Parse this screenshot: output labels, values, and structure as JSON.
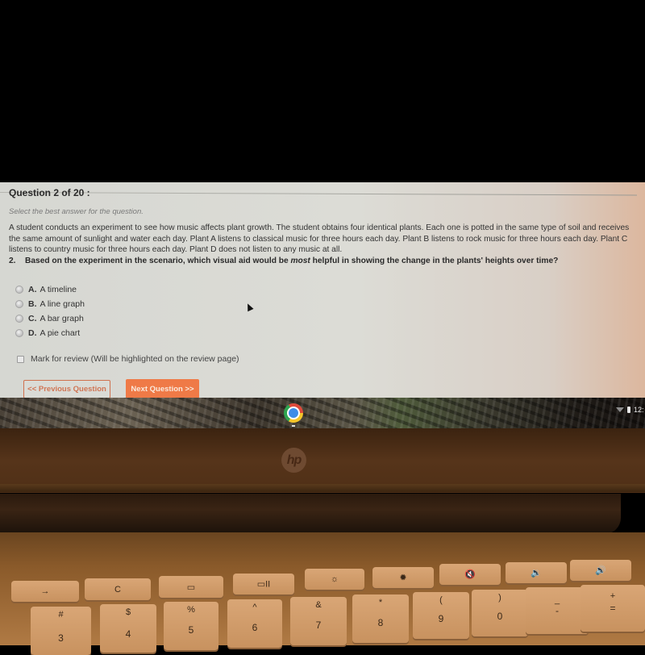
{
  "quiz": {
    "title": "Question 2 of 20 :",
    "instructions": "Select the best answer for the question.",
    "scenario": "A student conducts an experiment to see how music affects plant growth. The student obtains four identical plants. Each one is potted in the same type of soil and receives the same amount of sunlight and water each day. Plant A listens to classical music for three hours each day. Plant B listens to rock music for three hours each day. Plant C listens to country music for three hours each day. Plant D does not listen to any music at all.",
    "question_number": "2.",
    "question_before": "Based on the experiment in the scenario, which visual aid would be ",
    "question_emphasis": "most",
    "question_after": " helpful in showing the change in the plants' heights over time?",
    "options": [
      {
        "letter": "A.",
        "text": "A timeline",
        "selected": false
      },
      {
        "letter": "B.",
        "text": "A line graph",
        "selected": false
      },
      {
        "letter": "C.",
        "text": "A bar graph",
        "selected": false
      },
      {
        "letter": "D.",
        "text": "A pie chart",
        "selected": false
      }
    ],
    "mark_for_review": {
      "label": "Mark for review (Will be highlighted on the review page)",
      "checked": false
    },
    "prev_button": "<< Previous Question",
    "next_button": "Next Question >>",
    "accent_color": "#ef7a47"
  },
  "shelf": {
    "apps": [
      {
        "name": "Google Chrome",
        "icon": "chrome-icon"
      }
    ],
    "tray": {
      "wifi_icon": "wifi-icon",
      "battery_icon": "battery-icon",
      "time": "12:"
    }
  },
  "laptop": {
    "logo": "hp",
    "keyboard": {
      "function_row": [
        {
          "icon": "forward-icon",
          "glyph": "→"
        },
        {
          "icon": "refresh-icon",
          "glyph": "C"
        },
        {
          "icon": "fullscreen-icon",
          "glyph": "▭"
        },
        {
          "icon": "overview-icon",
          "glyph": "▭II"
        },
        {
          "icon": "brightness-down-icon",
          "glyph": "☼"
        },
        {
          "icon": "brightness-up-icon",
          "glyph": "✹"
        },
        {
          "icon": "mute-icon",
          "glyph": "🔇"
        },
        {
          "icon": "volume-down-icon",
          "glyph": "🔉"
        },
        {
          "icon": "volume-up-icon",
          "glyph": "🔊"
        }
      ],
      "number_row": [
        {
          "top": "#",
          "bottom": "3"
        },
        {
          "top": "$",
          "bottom": "4"
        },
        {
          "top": "%",
          "bottom": "5"
        },
        {
          "top": "^",
          "bottom": "6"
        },
        {
          "top": "&",
          "bottom": "7"
        },
        {
          "top": "*",
          "bottom": "8"
        },
        {
          "top": "(",
          "bottom": "9"
        },
        {
          "top": ")",
          "bottom": "0"
        },
        {
          "top": "_",
          "bottom": "-"
        },
        {
          "top": "+",
          "bottom": "="
        }
      ]
    }
  }
}
